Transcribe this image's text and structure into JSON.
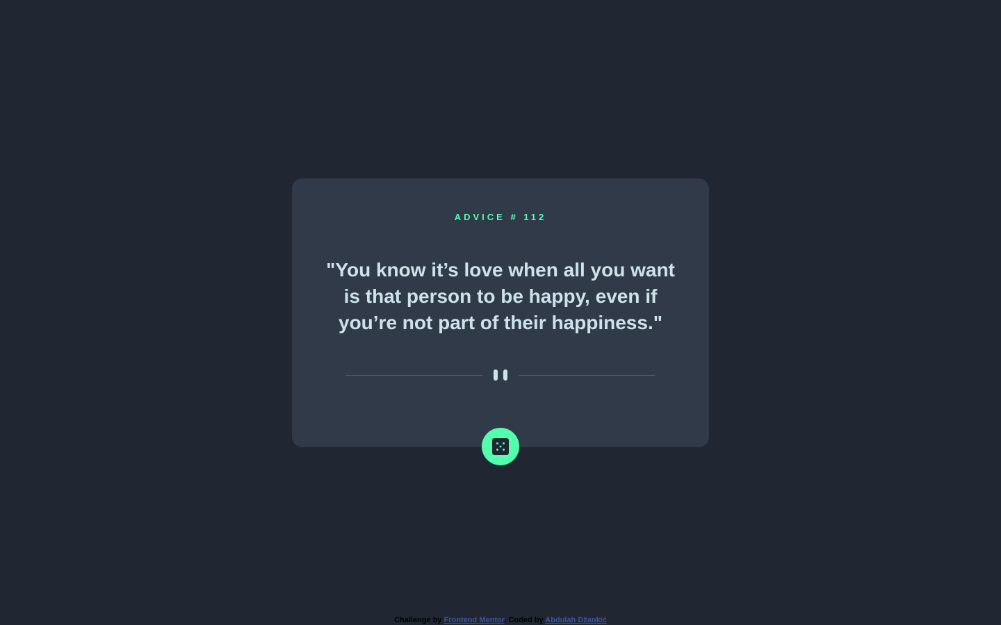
{
  "advice": {
    "id_label": "ADVICE # 112",
    "text": "\"You know it’s love when all you want is that person to be happy, even if you’re not part of their happiness.\""
  },
  "divider": {
    "icon": "pause-icon"
  },
  "dice_button": {
    "icon": "dice-icon"
  },
  "footer": {
    "challenge_prefix": "Challenge by ",
    "challenge_link": "Frontend Mentor",
    "separator": ". ",
    "coded_prefix": "Coded by ",
    "coded_link": "Abdulah Džankić"
  },
  "colors": {
    "background": "#202733",
    "card": "#313a49",
    "accent": "#53ffaa",
    "text": "#cee3e9",
    "divider": "#4f5d74",
    "link": "#3e52a3"
  }
}
